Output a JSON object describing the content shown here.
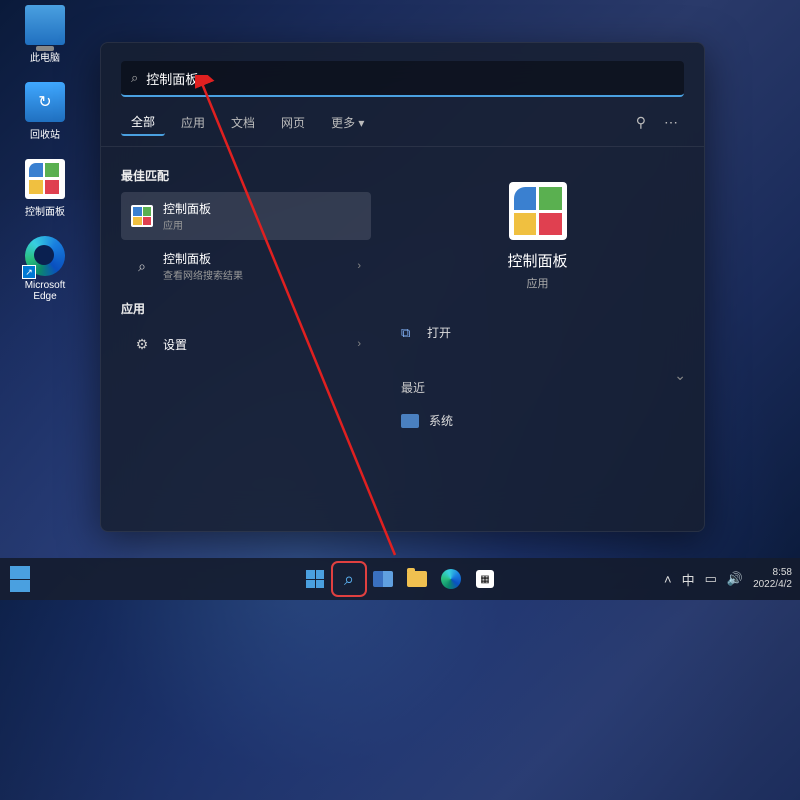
{
  "desktop": {
    "icons": [
      {
        "label": "此电脑",
        "name": "this-pc"
      },
      {
        "label": "回收站",
        "name": "recycle-bin"
      },
      {
        "label": "控制面板",
        "name": "control-panel"
      },
      {
        "label": "Microsoft Edge",
        "name": "edge"
      }
    ]
  },
  "search": {
    "query": "控制面板",
    "filters": {
      "all": "全部",
      "apps": "应用",
      "docs": "文档",
      "web": "网页",
      "more": "更多"
    },
    "sections": {
      "best_match": "最佳匹配",
      "apps": "应用"
    },
    "results": {
      "best": {
        "name": "控制面板",
        "sub": "应用"
      },
      "web": {
        "name": "控制面板",
        "sub": "查看网络搜索结果"
      },
      "settings": {
        "name": "设置"
      }
    },
    "preview": {
      "title": "控制面板",
      "subtitle": "应用",
      "open": "打开",
      "recent_header": "最近",
      "recent_item": "系统"
    }
  },
  "taskbar": {
    "time": "8:58",
    "date": "2022/4/2",
    "ime": "中"
  }
}
